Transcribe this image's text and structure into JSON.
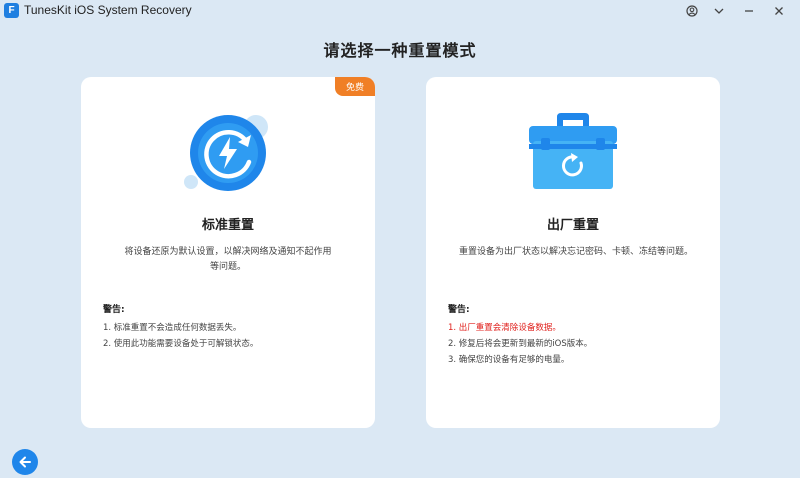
{
  "window": {
    "logo_letter": "F",
    "title": "TunesKit iOS System Recovery"
  },
  "header": {
    "title": "请选择一种重置模式"
  },
  "cards": [
    {
      "badge": "免费",
      "title": "标准重置",
      "description": "将设备还原为默认设置，以解决网络及通知不起作用等问题。",
      "warning_title": "警告:",
      "warnings": [
        "1. 标准重置不会造成任何数据丢失。",
        "2. 使用此功能需要设备处于可解锁状态。"
      ]
    },
    {
      "title": "出厂重置",
      "description": "重置设备为出厂状态以解决忘记密码、卡顿、冻结等问题。",
      "warning_title": "警告:",
      "warnings": [
        "1. 出厂重置会清除设备数据。",
        "2. 修复后将会更新到最新的iOS版本。",
        "3. 确保您的设备有足够的电量。"
      ]
    }
  ],
  "colors": {
    "background": "#dbe8f4",
    "accent": "#1f86ea",
    "badge": "#f07f26",
    "warning_red": "#e0201c"
  },
  "icons": {
    "account": "account-circle-icon",
    "dropdown": "chevron-down-icon",
    "minimize": "minimize-icon",
    "close": "close-icon",
    "standard_reset": "refresh-bolt-icon",
    "factory_reset": "toolbox-refresh-icon",
    "back": "arrow-left-icon"
  }
}
